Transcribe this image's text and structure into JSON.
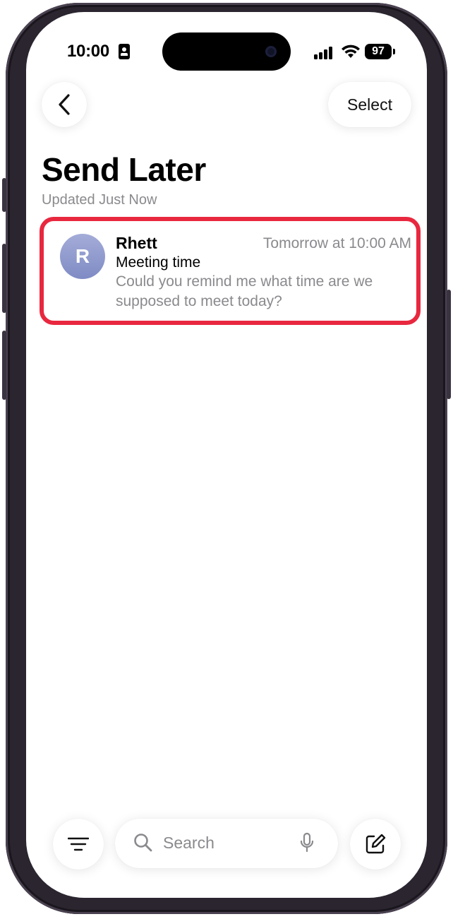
{
  "status_bar": {
    "time": "10:00",
    "battery": "97"
  },
  "nav": {
    "back_label": "",
    "select_label": "Select"
  },
  "header": {
    "title": "Send Later",
    "subtitle": "Updated Just Now"
  },
  "messages": [
    {
      "avatar_initial": "R",
      "sender": "Rhett",
      "timestamp": "Tomorrow at 10:00 AM",
      "subject": "Meeting time",
      "preview": "Could you remind me what time are we supposed to meet today?"
    }
  ],
  "bottom_bar": {
    "search_placeholder": "Search"
  },
  "colors": {
    "highlight": "#e8283f",
    "avatar_top": "#a4acd8",
    "avatar_bottom": "#7f8bc4",
    "secondary_text": "#8a8a8e"
  },
  "icons": {
    "back": "chevron-left-icon",
    "filter": "filter-lines-icon",
    "search": "magnifier-icon",
    "mic": "microphone-icon",
    "compose": "compose-icon"
  }
}
